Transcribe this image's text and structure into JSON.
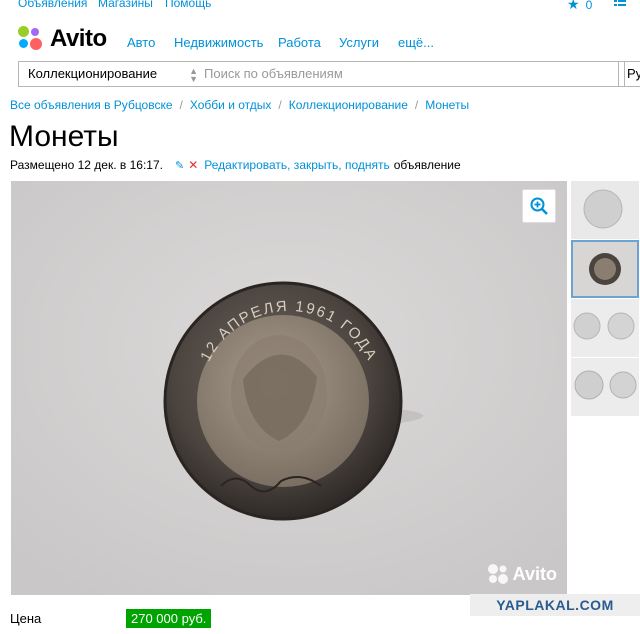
{
  "top_links": {
    "ads": "Объявления",
    "shops": "Магазины",
    "help": "Помощь",
    "fav_count": "0"
  },
  "logo": {
    "text": "Avito"
  },
  "nav": {
    "items": [
      "Авто",
      "Недвижимость",
      "Работа",
      "Услуги",
      "ещё..."
    ]
  },
  "search": {
    "category": "Коллекционирование",
    "placeholder": "Поиск по объявлениям",
    "region": "Ру"
  },
  "breadcrumb": [
    "Все объявления в Рубцовске",
    "Хобби и отдых",
    "Коллекционирование",
    "Монеты"
  ],
  "listing": {
    "title": "Монеты",
    "posted": "Размещено 12 дек. в 16:17.",
    "edit_link": "Редактировать, закрыть, поднять",
    "edit_suffix": "объявление",
    "coin_inscription": "12 АПРЕЛЯ 1961 ГОДА",
    "photo_watermark": "Avito",
    "price_label": "Цена",
    "price": "270 000 руб."
  },
  "site_watermark": "YAPLAKAL.COM",
  "colors": {
    "link": "#0091d9",
    "price_bg": "#00a400",
    "logo_green": "#97cf26",
    "logo_purple": "#a169f7",
    "logo_red": "#ff6163",
    "logo_blue": "#00aaff"
  }
}
